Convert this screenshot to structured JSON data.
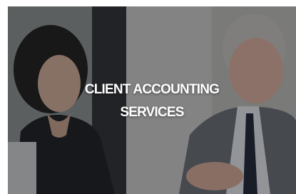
{
  "card": {
    "title_line1": "CLIENT ACCOUNTING",
    "title_line2": "SERVICES",
    "image_alt_icon": "meeting-photo-icon"
  },
  "colors": {
    "overlay": "#14161a",
    "title_text": "#ffffff"
  }
}
